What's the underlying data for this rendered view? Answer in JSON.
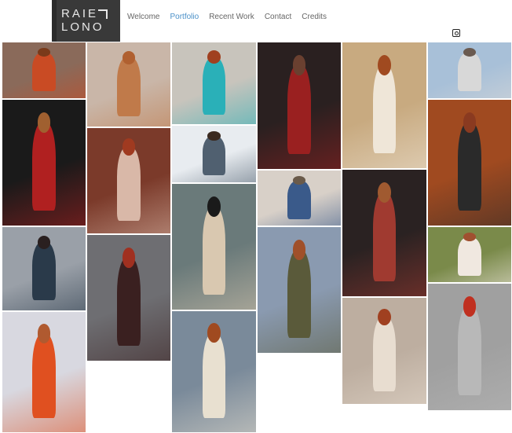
{
  "logo": {
    "line1": "RAIE",
    "line2": "LONO"
  },
  "nav": {
    "items": [
      {
        "label": "Welcome",
        "active": false
      },
      {
        "label": "Portfolio",
        "active": true
      },
      {
        "label": "Recent Work",
        "active": false
      },
      {
        "label": "Contact",
        "active": false
      },
      {
        "label": "Credits",
        "active": false
      }
    ]
  },
  "social": {
    "icon": "instagram-icon"
  },
  "colors": {
    "accent": "#4a90c8",
    "nav_text": "#666666",
    "logo_bg": "#393939"
  },
  "gallery": [
    {
      "bg": "#8a6a5a",
      "fig": "#c94b24",
      "head": "#7a3a1a"
    },
    {
      "bg": "#1a1a1a",
      "fig": "#b02020",
      "head": "#a06030"
    },
    {
      "bg": "#9aa0a8",
      "fig": "#2a3a4a",
      "head": "#2a2020"
    },
    {
      "bg": "#d8d8e0",
      "fig": "#e05020",
      "head": "#b05a30"
    },
    {
      "bg": "#c9b6a8",
      "fig": "#c07a4a",
      "head": "#b06030"
    },
    {
      "bg": "#7b3a2a",
      "fig": "#d9b8a8",
      "head": "#a03a20"
    },
    {
      "bg": "#6e6e72",
      "fig": "#3a2020",
      "head": "#a03020"
    },
    {
      "bg": "#c8c4bc",
      "fig": "#2ab0b8",
      "head": "#a04020"
    },
    {
      "bg": "#e8ecf0",
      "fig": "#506070",
      "head": "#3a2a20"
    },
    {
      "bg": "#6a7a7a",
      "fig": "#d9c8b0",
      "head": "#1a1a1a"
    },
    {
      "bg": "#7a8a9a",
      "fig": "#e8e0d0",
      "head": "#a04a20"
    },
    {
      "bg": "#2a2020",
      "fig": "#9a2020",
      "head": "#6a4030"
    },
    {
      "bg": "#d8d0c8",
      "fig": "#3a5a8a",
      "head": "#6a5a4a"
    },
    {
      "bg": "#8a9ab0",
      "fig": "#5a5a3a",
      "head": "#a0502a"
    },
    {
      "bg": "#c8aa80",
      "fig": "#efe6d8",
      "head": "#a04a20"
    },
    {
      "bg": "#2a2222",
      "fig": "#a03a30",
      "head": "#a05a30"
    },
    {
      "bg": "#bdaea0",
      "fig": "#e8ddd0",
      "head": "#a04020"
    },
    {
      "bg": "#a8c0d8",
      "fig": "#d8d8d8",
      "head": "#6a5a50"
    },
    {
      "bg": "#a04a20",
      "fig": "#2a2a2a",
      "head": "#8a3a20"
    },
    {
      "bg": "#7a8a4a",
      "fig": "#f0e8e0",
      "head": "#a05030"
    },
    {
      "bg": "#a0a0a0",
      "fig": "#b8b8b8",
      "head": "#c03020"
    }
  ]
}
